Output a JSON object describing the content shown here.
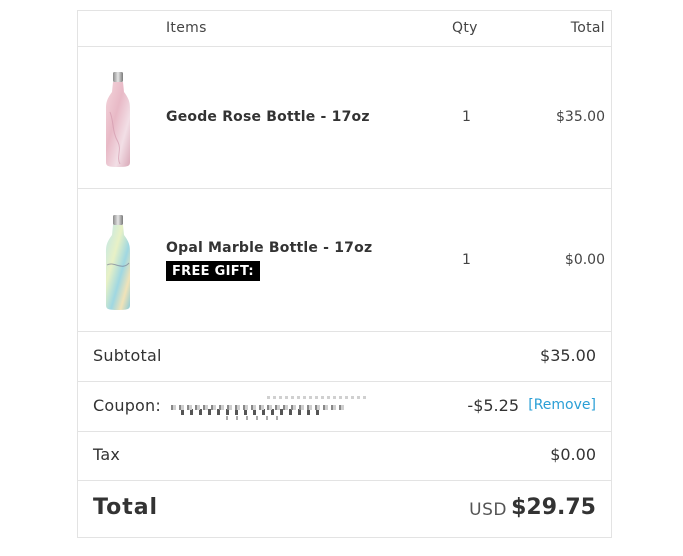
{
  "header": {
    "items": "Items",
    "qty": "Qty",
    "total": "Total"
  },
  "items": [
    {
      "name": "Geode Rose Bottle - 17oz",
      "qty": "1",
      "total": "$35.00",
      "thumb_icon": "rose-bottle-image"
    },
    {
      "name": "Opal Marble Bottle - 17oz",
      "qty": "1",
      "total": "$0.00",
      "badge": "FREE GIFT:",
      "thumb_icon": "opal-bottle-image"
    }
  ],
  "summary": {
    "subtotal_label": "Subtotal",
    "subtotal_value": "$35.00",
    "coupon_label": "Coupon:",
    "coupon_amount": "-$5.25",
    "coupon_remove": "[Remove]",
    "tax_label": "Tax",
    "tax_value": "$0.00",
    "total_label": "Total",
    "total_currency": "USD",
    "total_value": "$29.75"
  },
  "colors": {
    "link": "#2a9fd6",
    "border": "#e3e3e3",
    "badge_bg": "#000000"
  }
}
